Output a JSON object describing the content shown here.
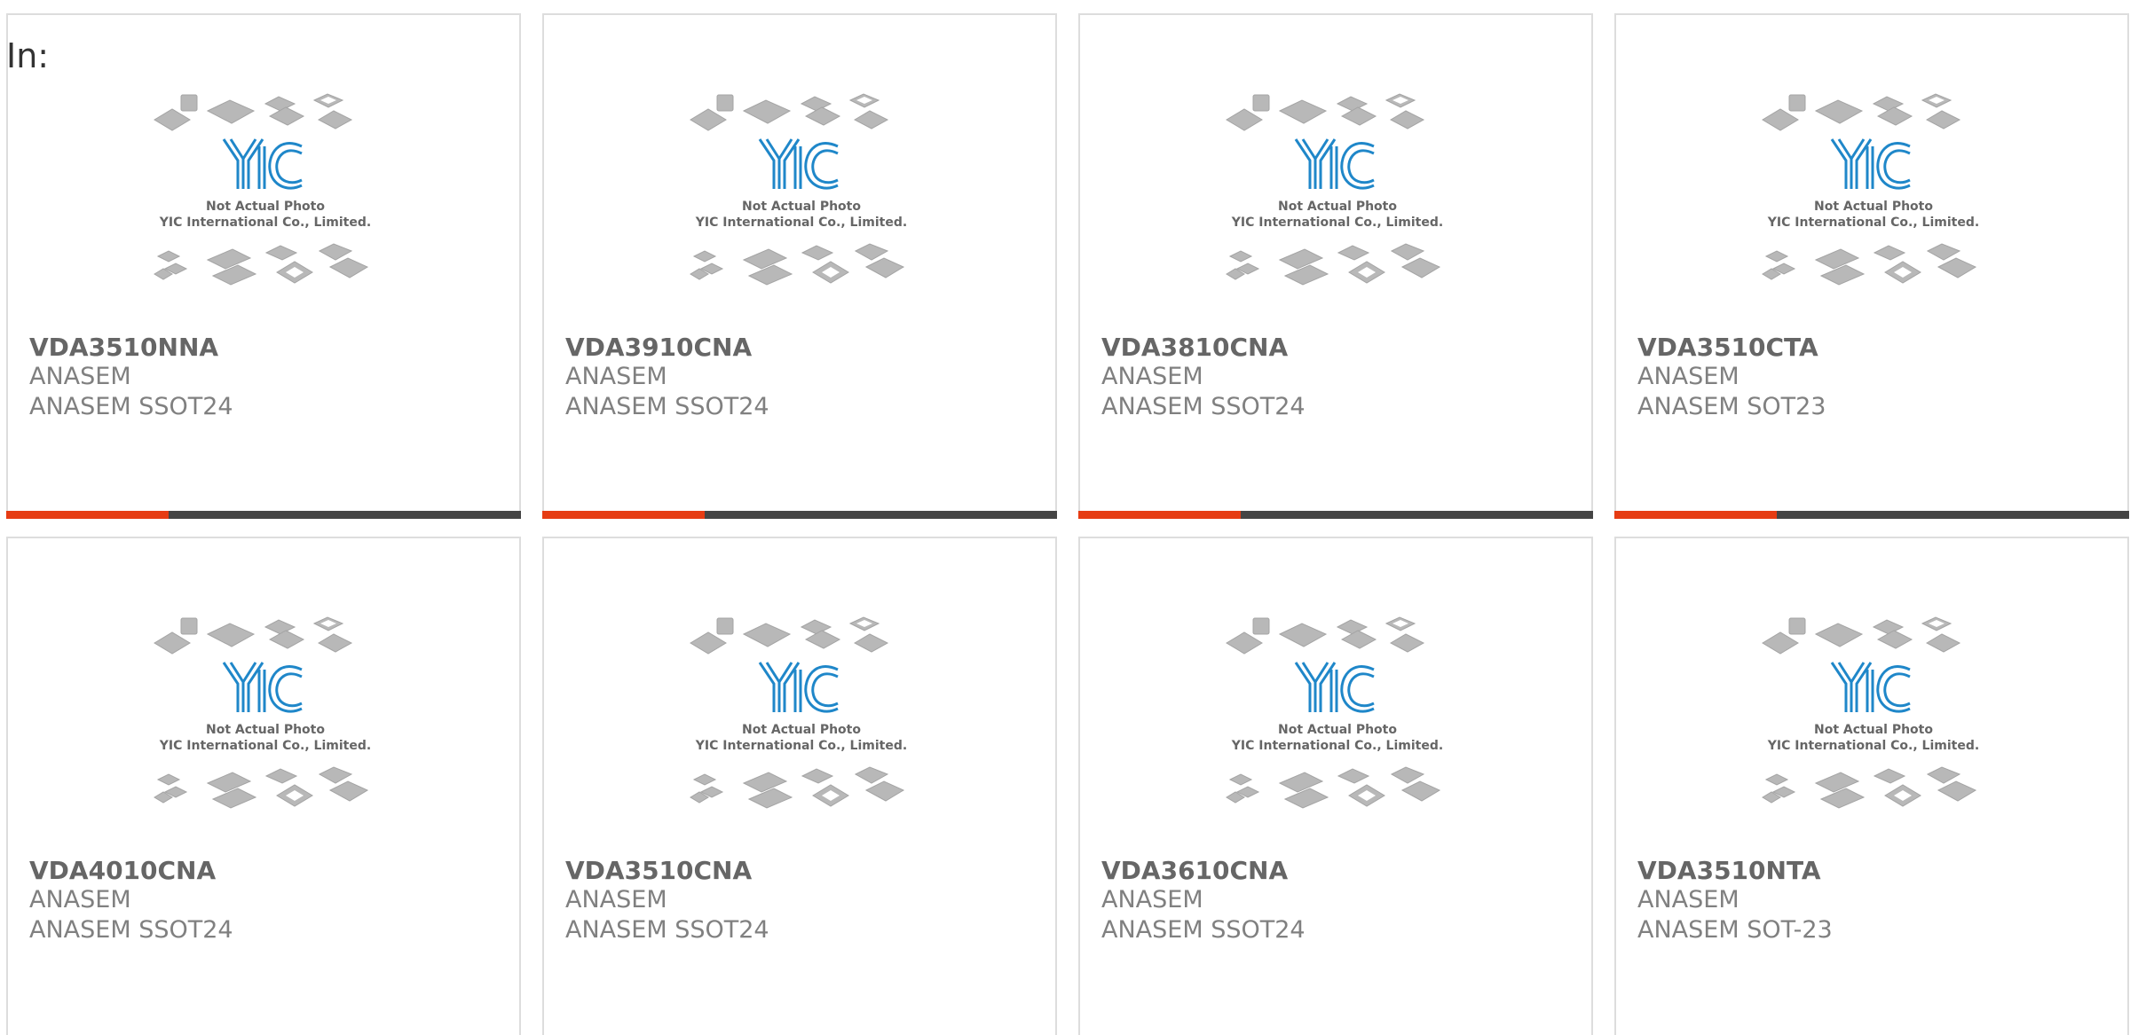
{
  "header": {
    "label": "In:"
  },
  "photo": {
    "caption_line1": "Not Actual Photo",
    "caption_line2": "YIC International Co., Limited.",
    "logo_icon": "yic-logo-icon"
  },
  "colors": {
    "accent": "#e63c13",
    "bar_dark": "#444444",
    "logo_blue": "#1f87c9",
    "chip_gray": "#b5b5b5",
    "text_bold": "#666666",
    "text_light": "#808080"
  },
  "products": [
    {
      "part_number": "VDA3510NNA",
      "manufacturer": "ANASEM",
      "package": "ANASEM SSOT24"
    },
    {
      "part_number": "VDA3910CNA",
      "manufacturer": "ANASEM",
      "package": "ANASEM SSOT24"
    },
    {
      "part_number": "VDA3810CNA",
      "manufacturer": "ANASEM",
      "package": "ANASEM SSOT24"
    },
    {
      "part_number": "VDA3510CTA",
      "manufacturer": "ANASEM",
      "package": "ANASEM SOT23"
    },
    {
      "part_number": "VDA4010CNA",
      "manufacturer": "ANASEM",
      "package": "ANASEM SSOT24"
    },
    {
      "part_number": "VDA3510CNA",
      "manufacturer": "ANASEM",
      "package": "ANASEM SSOT24"
    },
    {
      "part_number": "VDA3610CNA",
      "manufacturer": "ANASEM",
      "package": "ANASEM SSOT24"
    },
    {
      "part_number": "VDA3510NTA",
      "manufacturer": "ANASEM",
      "package": "ANASEM SOT-23"
    }
  ]
}
